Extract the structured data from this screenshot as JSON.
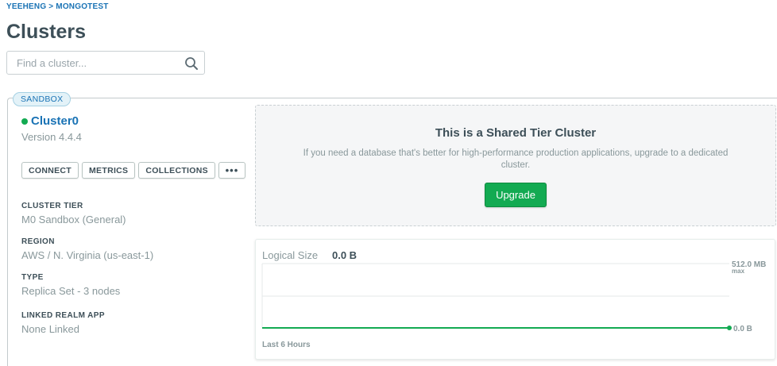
{
  "breadcrumb": "YEEHENG > MONGOTEST",
  "page_title": "Clusters",
  "search": {
    "placeholder": "Find a cluster...",
    "value": ""
  },
  "cluster": {
    "badge": "SANDBOX",
    "name": "Cluster0",
    "status_color": "#13aa52",
    "version": "Version 4.4.4",
    "buttons": {
      "connect": "CONNECT",
      "metrics": "METRICS",
      "collections": "COLLECTIONS",
      "more": "•••"
    },
    "info": [
      {
        "label": "CLUSTER TIER",
        "value": "M0 Sandbox (General)"
      },
      {
        "label": "REGION",
        "value": "AWS / N. Virginia (us-east-1)"
      },
      {
        "label": "TYPE",
        "value": "Replica Set - 3 nodes"
      },
      {
        "label": "LINKED REALM APP",
        "value": "None Linked"
      }
    ]
  },
  "shared_tier": {
    "title": "This is a Shared Tier Cluster",
    "description": "If you need a database that's better for high-performance production applications, upgrade to a dedicated cluster.",
    "upgrade_label": "Upgrade"
  },
  "metric": {
    "label": "Logical Size",
    "value": "0.0 B",
    "max_label": "512.0 MB",
    "max_sub": "max",
    "current_label": "0.0 B",
    "footer": "Last 6 Hours",
    "line_color": "#13aa52"
  }
}
